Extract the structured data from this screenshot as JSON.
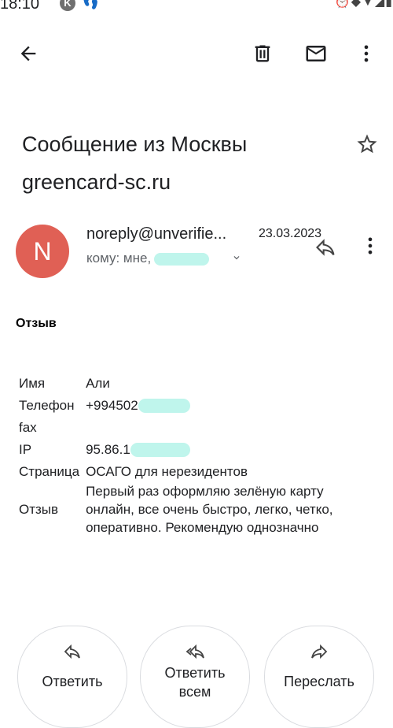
{
  "status_bar": {
    "time": "18:10",
    "k_badge": "K"
  },
  "toolbar": {
    "back_icon": "arrow-back-icon",
    "delete_icon": "trash-icon",
    "mark_unread_icon": "mail-icon",
    "more_icon": "more-vert-icon"
  },
  "subject": {
    "line1": "Сообщение из Москвы",
    "line2": "greencard-sc.ru"
  },
  "sender": {
    "avatar_letter": "N",
    "avatar_color": "#e06055",
    "address": "noreply@unverifie...",
    "date": "23.03.2023",
    "to_prefix": "кому: мне,"
  },
  "body": {
    "title": "Отзыв",
    "rows": [
      {
        "label": "Имя",
        "value": "Али"
      },
      {
        "label": "Телефон",
        "value": "+994502"
      },
      {
        "label": "fax",
        "value": ""
      },
      {
        "label": "IP",
        "value": "95.86.1"
      },
      {
        "label": "Страница",
        "value": "ОСАГО для нерезидентов"
      },
      {
        "label": "Отзыв",
        "value": "Первый раз оформляю зелёную карту онлайн, все очень быстро, легко, четко, оперативно. Рекомендую однозначно"
      }
    ]
  },
  "actions": {
    "reply": "Ответить",
    "reply_all_line1": "Ответить",
    "reply_all_line2": "всем",
    "forward": "Переслать"
  }
}
